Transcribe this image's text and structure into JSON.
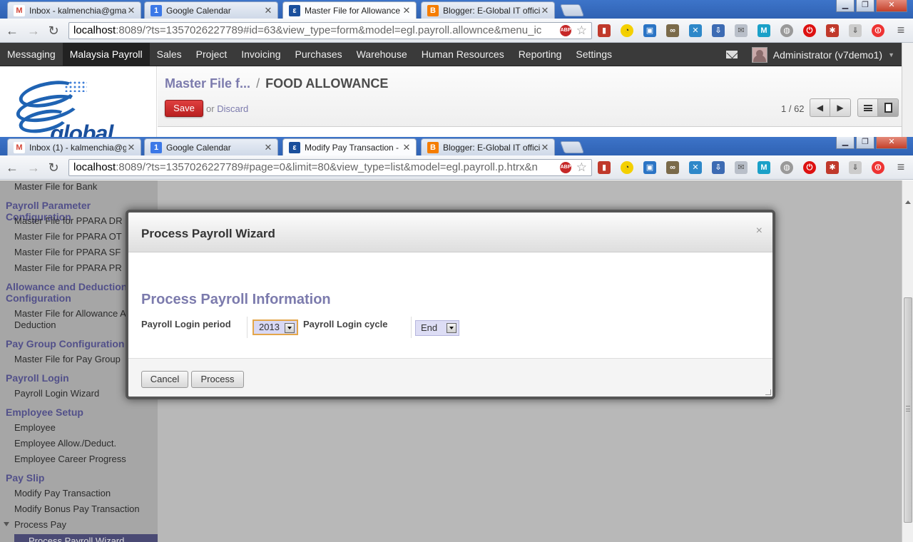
{
  "window1": {
    "tabs": [
      {
        "title": "Inbox - kalmenchia@gma",
        "fav": "M",
        "fav_color": "#d44638"
      },
      {
        "title": "Google Calendar",
        "fav": "1",
        "fav_color": "#3b78e7"
      },
      {
        "title": "Master File for Allowance",
        "fav": "ε",
        "fav_color": "#1a4f9c"
      },
      {
        "title": "Blogger: E-Global IT offici",
        "fav": "B",
        "fav_color": "#f57d00"
      }
    ],
    "url_host": "localhost",
    "url_rest": ":8089/?ts=1357026227789#id=63&view_type=form&model=egl.payroll.allownce&menu_ic"
  },
  "window2": {
    "tabs": [
      {
        "title": "Inbox (1) - kalmenchia@g",
        "fav": "M",
        "fav_color": "#d44638"
      },
      {
        "title": "Google Calendar",
        "fav": "1",
        "fav_color": "#3b78e7"
      },
      {
        "title": "Modify Pay Transaction -",
        "fav": "ε",
        "fav_color": "#1a4f9c"
      },
      {
        "title": "Blogger: E-Global IT offici",
        "fav": "B",
        "fav_color": "#f57d00"
      }
    ],
    "url_host": "localhost",
    "url_rest": ":8089/?ts=1357026227789#page=0&limit=80&view_type=list&model=egl.payroll.p.htrx&n"
  },
  "topmenu": [
    "Messaging",
    "Malaysia Payroll",
    "Sales",
    "Project",
    "Invoicing",
    "Purchases",
    "Warehouse",
    "Human Resources",
    "Reporting",
    "Settings"
  ],
  "user": {
    "name": "Administrator (v7demo1)"
  },
  "logo": {
    "text": "global"
  },
  "breadcrumb": {
    "parent": "Master File f...",
    "separator": "/",
    "current": "FOOD ALLOWANCE"
  },
  "form_actions": {
    "save": "Save",
    "or": "or",
    "discard": "Discard"
  },
  "pager": {
    "text": "1 / 62"
  },
  "sidebar": {
    "item_bank": "Master File for Bank",
    "h_param": "Payroll Parameter Configuration",
    "ppara": [
      "Master File for PPARA DR",
      "Master File for PPARA OT",
      "Master File for PPARA SF",
      "Master File for PPARA PR"
    ],
    "h_allow_1": "Allowance and Deduction",
    "h_allow_2": "Configuration",
    "allow_item_1": "Master File for Allowance And",
    "allow_item_2": "Deduction",
    "h_paygroup": "Pay Group Configuration",
    "paygroup_item": "Master File for Pay Group",
    "h_login": "Payroll Login",
    "login_item": "Payroll Login Wizard",
    "h_employee": "Employee Setup",
    "employee_items": [
      "Employee",
      "Employee Allow./Deduct.",
      "Employee Career Progress"
    ],
    "h_payslip": "Pay Slip",
    "payslip_items": [
      "Modify Pay Transaction",
      "Modify Bonus Pay Transaction"
    ],
    "process_pay": "Process Pay",
    "selected": "Process Payroll Wizard"
  },
  "modal": {
    "title": "Process Payroll Wizard",
    "close": "×",
    "section": "Process Payroll Information",
    "period_label": "Payroll Login period",
    "period_value": "2013",
    "cycle_label": "Payroll Login cycle",
    "cycle_value": "End",
    "cancel": "Cancel",
    "process": "Process"
  },
  "colors": {
    "accent": "#7c7bad",
    "save": "#c92a2a",
    "topbar": "#3a3a3a"
  }
}
